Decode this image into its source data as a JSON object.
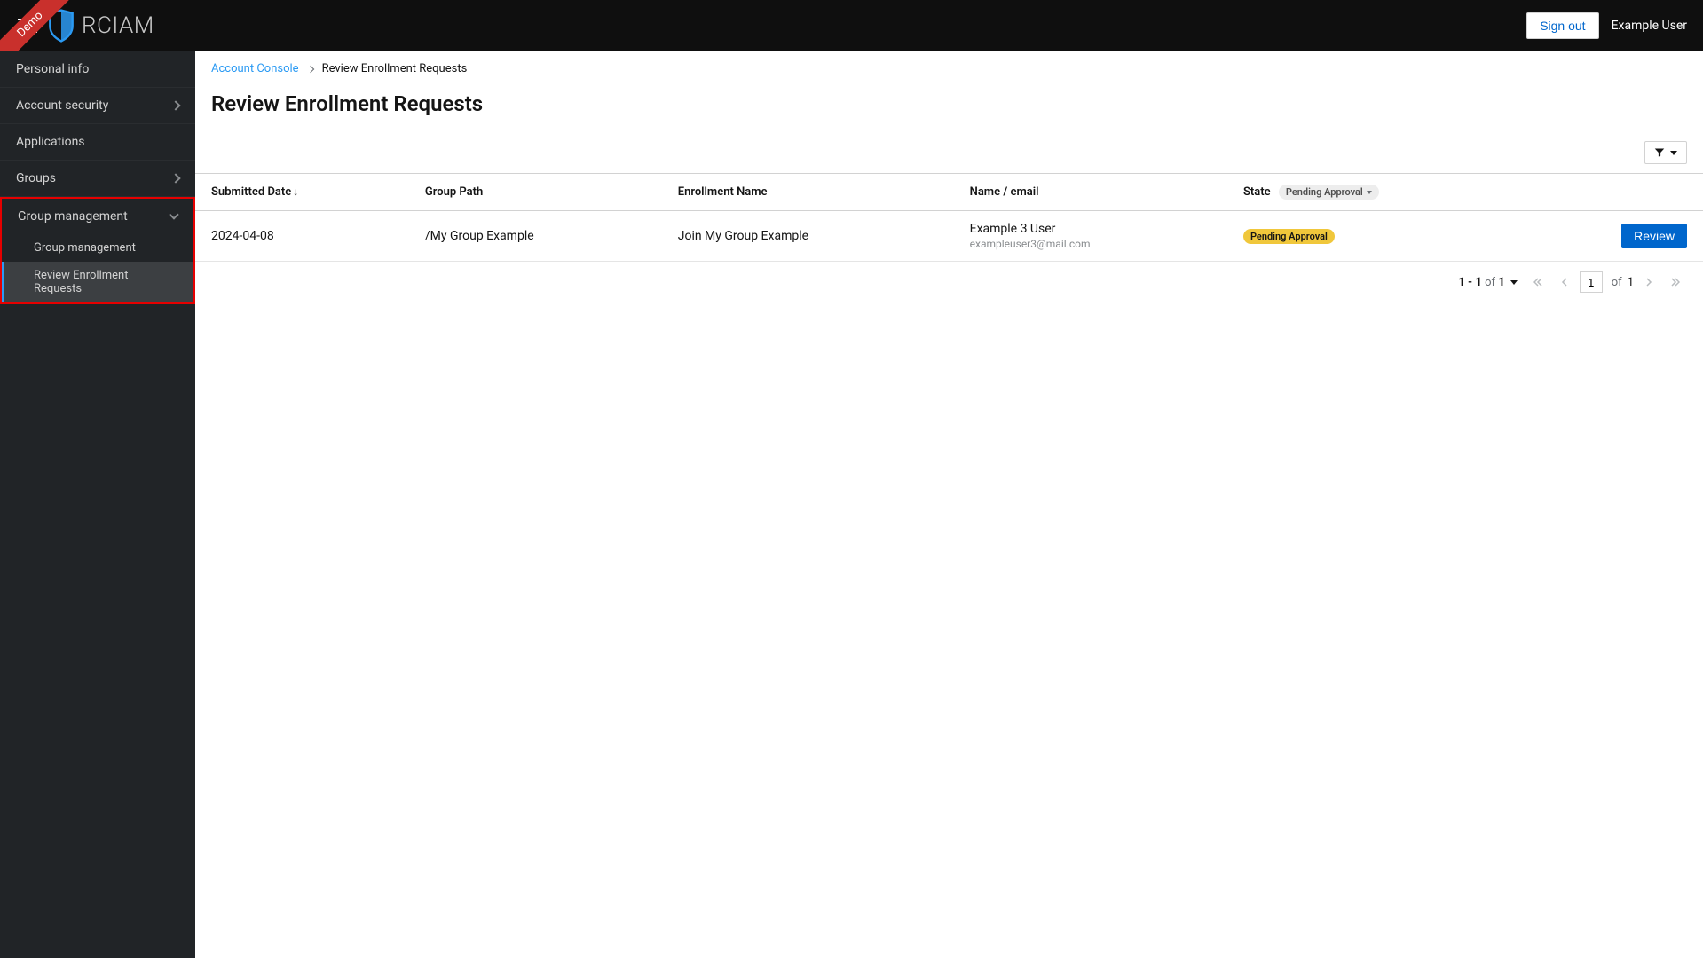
{
  "header": {
    "demo_ribbon": "Demo",
    "logo_text": "RCIAM",
    "signout_label": "Sign out",
    "username": "Example User"
  },
  "sidebar": {
    "items": [
      {
        "label": "Personal info",
        "expandable": false
      },
      {
        "label": "Account security",
        "expandable": true
      },
      {
        "label": "Applications",
        "expandable": false
      },
      {
        "label": "Groups",
        "expandable": true
      }
    ],
    "group_management": {
      "label": "Group management",
      "sub": [
        {
          "label": "Group management",
          "active": false
        },
        {
          "label": "Review Enrollment Requests",
          "active": true
        }
      ]
    }
  },
  "breadcrumb": {
    "root": "Account Console",
    "current": "Review Enrollment Requests"
  },
  "page": {
    "title": "Review Enrollment Requests"
  },
  "table": {
    "columns": {
      "submitted_date": "Submitted Date",
      "group_path": "Group Path",
      "enrollment_name": "Enrollment Name",
      "name_email": "Name / email",
      "state": "State",
      "state_filter": "Pending Approval"
    },
    "rows": [
      {
        "submitted_date": "2024-04-08",
        "group_path": "/My Group Example",
        "enrollment_name": "Join My Group Example",
        "name": "Example 3 User",
        "email": "exampleuser3@mail.com",
        "state_badge": "Pending Approval",
        "action_label": "Review"
      }
    ]
  },
  "pagination": {
    "range": "1 - 1",
    "of_label": "of",
    "total": "1",
    "page_value": "1",
    "page_of_label": "of",
    "page_total": "1"
  }
}
